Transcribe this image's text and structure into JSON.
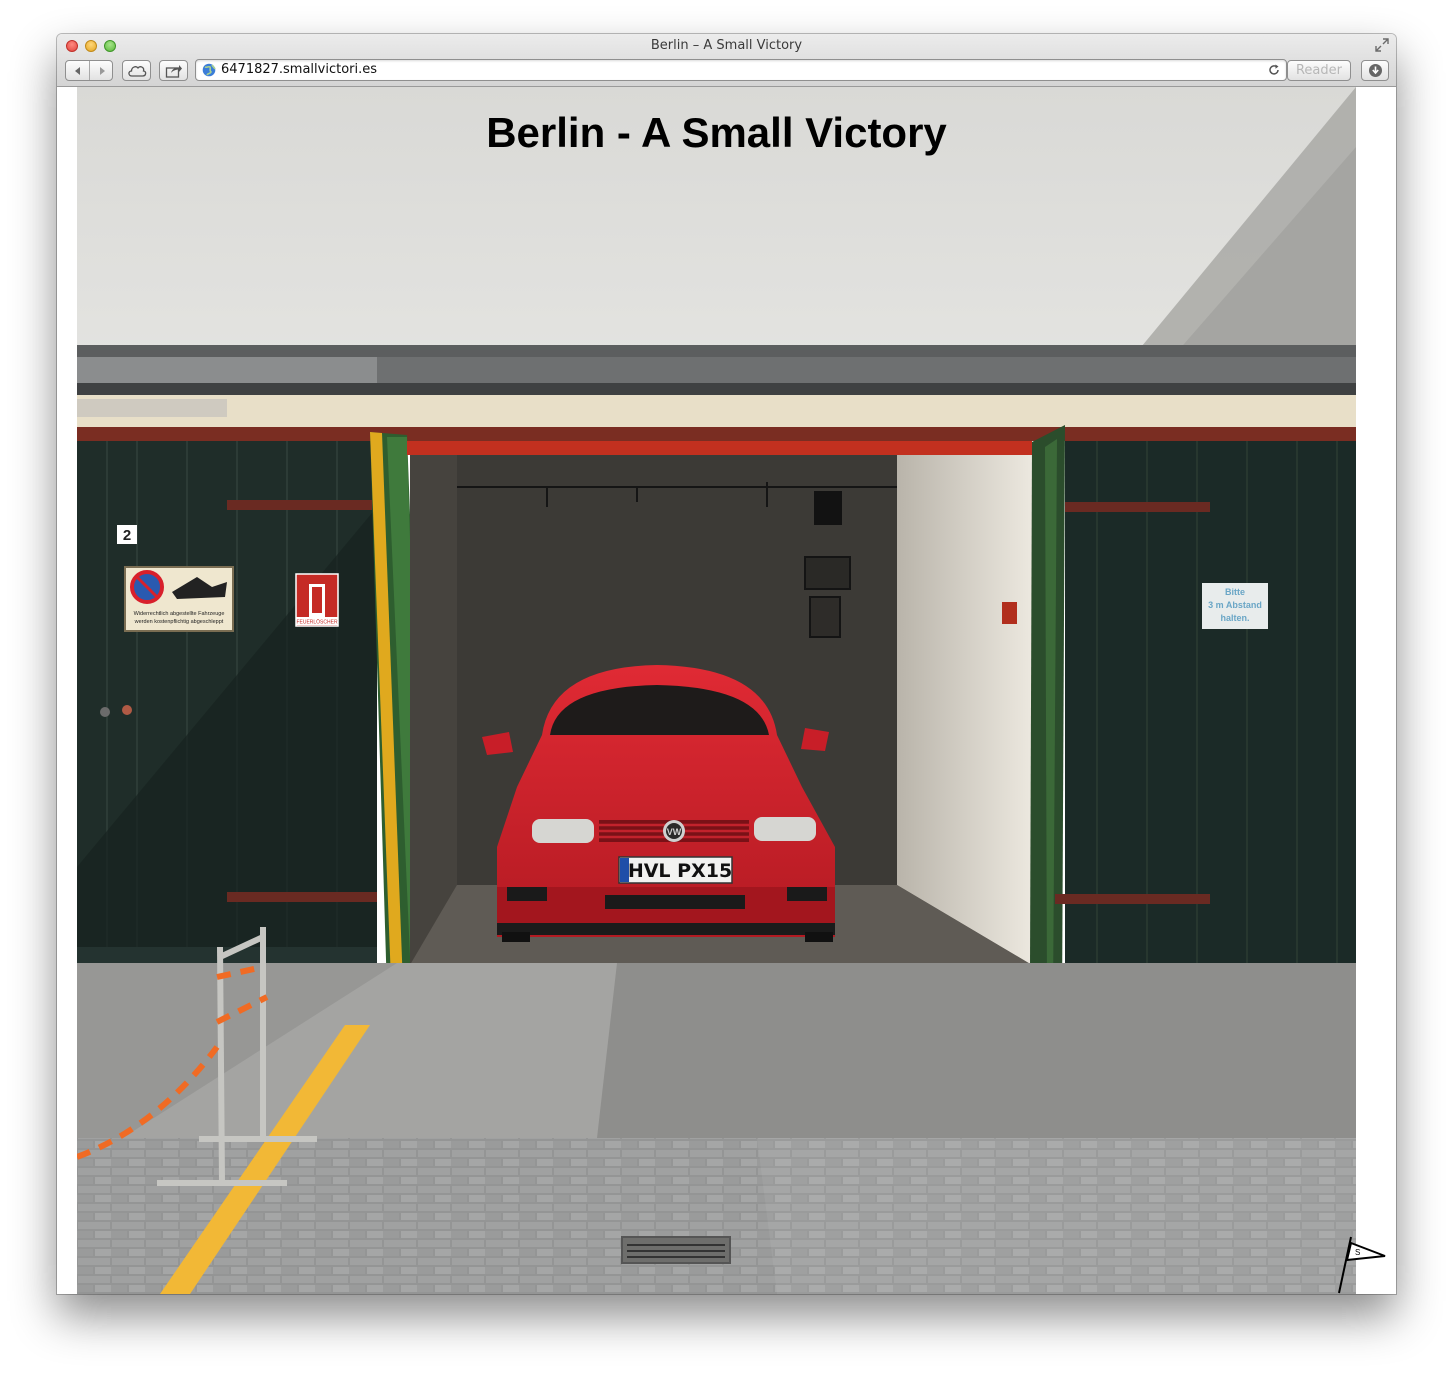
{
  "window": {
    "title": "Berlin – A Small Victory"
  },
  "toolbar": {
    "url": "6471827.smallvictori.es",
    "reader_label": "Reader"
  },
  "page": {
    "heading": "Berlin - A Small Victory"
  },
  "photo": {
    "garage_number": "2",
    "license_plate": "HVL PX15",
    "left_sign": "Widerrechtlich abgestellte Fahrzeuge werden kostenpflichtig abgeschleppt",
    "extinguisher_sign": "FEUERLÖSCHER",
    "right_sign_line1": "Bitte",
    "right_sign_line2": "3 m Abstand",
    "right_sign_line3": "halten."
  },
  "colors": {
    "car_red": "#d8202b",
    "door_green": "#1f2d29",
    "wall": "#dcdcd9",
    "pavement": "#9a9a98",
    "yellow_line": "#f2b836"
  }
}
